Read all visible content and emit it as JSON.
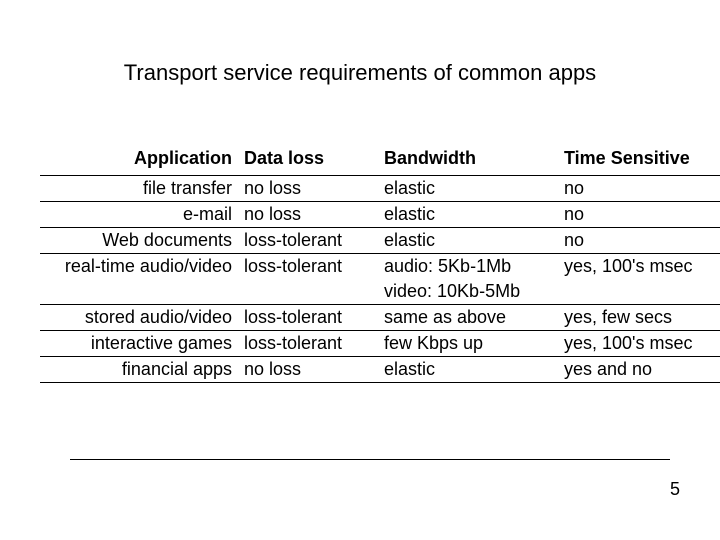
{
  "title": "Transport service requirements of common apps",
  "headers": {
    "application": "Application",
    "data_loss": "Data loss",
    "bandwidth": "Bandwidth",
    "time_sensitive": "Time Sensitive"
  },
  "rows": [
    {
      "app": "file transfer",
      "loss": "no loss",
      "bw": "elastic",
      "bw2": "",
      "time": "no"
    },
    {
      "app": "e-mail",
      "loss": "no loss",
      "bw": "elastic",
      "bw2": "",
      "time": "no"
    },
    {
      "app": "Web documents",
      "loss": "loss-tolerant",
      "bw": "elastic",
      "bw2": "",
      "time": "no"
    },
    {
      "app": "real-time audio/video",
      "loss": "loss-tolerant",
      "bw": "audio: 5Kb-1Mb",
      "bw2": "video: 10Kb-5Mb",
      "time": "yes, 100's msec"
    },
    {
      "app": "stored audio/video",
      "loss": "loss-tolerant",
      "bw": "same as above",
      "bw2": "",
      "time": "yes, few secs"
    },
    {
      "app": "interactive games",
      "loss": "loss-tolerant",
      "bw": "few Kbps up",
      "bw2": "",
      "time": "yes, 100's msec"
    },
    {
      "app": "financial apps",
      "loss": "no loss",
      "bw": "elastic",
      "bw2": "",
      "time": "yes and no"
    }
  ],
  "page_number": "5"
}
